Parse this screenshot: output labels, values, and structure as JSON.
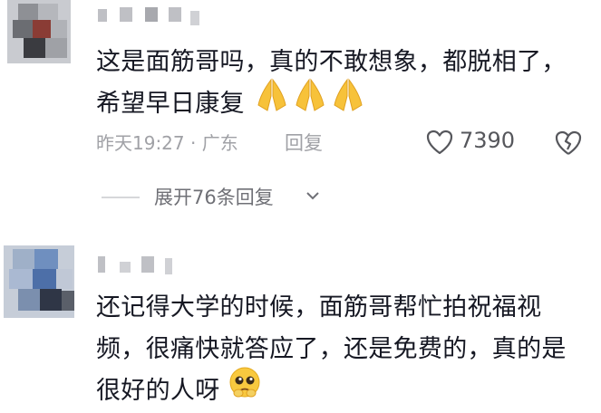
{
  "comments": [
    {
      "text": "这是面筋哥吗，真的不敢想象，都脱相了，希望早日康复",
      "emoji": "folded-hands-x3",
      "time": "昨天19:27",
      "location": "广东",
      "reply_label": "回复",
      "likes": "7390",
      "expand_label": "展开76条回复"
    },
    {
      "text": "还记得大学的时候，面筋哥帮忙拍祝福视频，很痛快就答应了，还是免费的，真的是很好的人呀",
      "emoji": "pleading-face"
    }
  ],
  "colors": {
    "meta": "#a0a1a6",
    "text": "#161823",
    "like": "#56575c"
  },
  "icons": [
    "heart-icon",
    "broken-heart-icon",
    "chevron-down-icon"
  ]
}
